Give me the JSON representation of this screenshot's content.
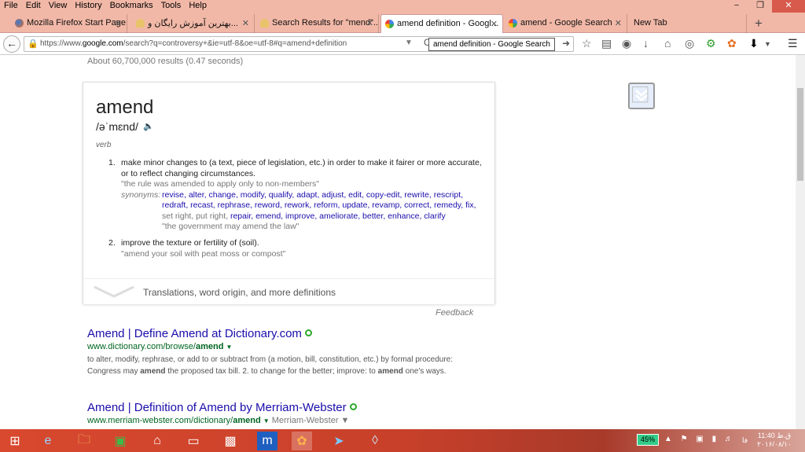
{
  "menu": [
    "File",
    "Edit",
    "View",
    "History",
    "Bookmarks",
    "Tools",
    "Help"
  ],
  "window_controls": [
    "−",
    "❐",
    "✕"
  ],
  "tabs": [
    {
      "label": "Mozilla Firefox Start Page",
      "close": "✕"
    },
    {
      "label": "بهترین آموزش رایگان و...",
      "close": "✕"
    },
    {
      "label": "Search Results for \"mend\"...",
      "close": "✕"
    },
    {
      "label": "amend definition - Googl...",
      "close": "✕"
    },
    {
      "label": "amend - Google Search",
      "close": "✕"
    },
    {
      "label": "New Tab",
      "close": ""
    }
  ],
  "new_tab_glyph": "+",
  "nav": {
    "url_prefix": "https://www.",
    "url_domain": "google.com",
    "url_rest": "/search?q=controversy+&ie=utf-8&oe=utf-8#q=amend+definition",
    "tooltip": "amend definition - Google Search"
  },
  "toolbar_icons": [
    "star-icon",
    "reading-list-icon",
    "pocket-icon",
    "download-arrow-icon",
    "home-icon",
    "chat-icon",
    "addon-icon",
    "firefox-icon",
    "download-icon",
    "menu-icon"
  ],
  "stats": "About 60,700,000 results (0.47 seconds)",
  "dictionary": {
    "word": "amend",
    "phonetic": "/əˈmɛnd/",
    "pos": "verb",
    "definitions": [
      {
        "num": "1.",
        "text": "make minor changes to (a text, piece of legislation, etc.) in order to make it fairer or more accurate, or to reflect changing circumstances.",
        "example": "\"the rule was amended to apply only to non-members\"",
        "syn_label": "synonyms:",
        "synonyms_a": "revise, alter, change, modify, qualify, adapt, adjust, edit, copy-edit, rewrite, rescript, redraft, recast, rephrase, reword, rework, reform, update, revamp, correct, remedy, fix,",
        "synonyms_gray": "set right, put right,",
        "synonyms_b": "repair, emend, improve, ameliorate, better, enhance, clarify",
        "syn_example": "\"the government may amend the law\""
      },
      {
        "num": "2.",
        "text": "improve the texture or fertility of (soil).",
        "example": "\"amend your soil with peat moss or compost\""
      }
    ],
    "more": "Translations, word origin, and more definitions",
    "feedback": "Feedback"
  },
  "results": [
    {
      "title": "Amend | Define Amend at Dictionary.com",
      "url_plain": "www.dictionary.com/browse/",
      "url_bold": "amend",
      "url_arrow": "▼",
      "url_extra": "",
      "snippet_1": "to alter, modify, rephrase, or add to or subtract from (a motion, bill, constitution, etc.) by formal procedure: Congress may ",
      "snippet_b1": "amend",
      "snippet_2": " the proposed tax bill. 2. to change for the better; improve: to ",
      "snippet_b2": "amend",
      "snippet_3": " one's ways."
    },
    {
      "title": "Amend | Definition of Amend by Merriam-Webster",
      "url_plain": "www.merriam-webster.com/dictionary/",
      "url_bold": "amend",
      "url_arrow": "▼",
      "url_extra": "Merriam-Webster ▼"
    }
  ],
  "taskbar": {
    "battery": "45%",
    "lang": "فا",
    "time": "11:40 ق.ظ",
    "date": "۲۰۱۶/۰۸/۱۰"
  }
}
